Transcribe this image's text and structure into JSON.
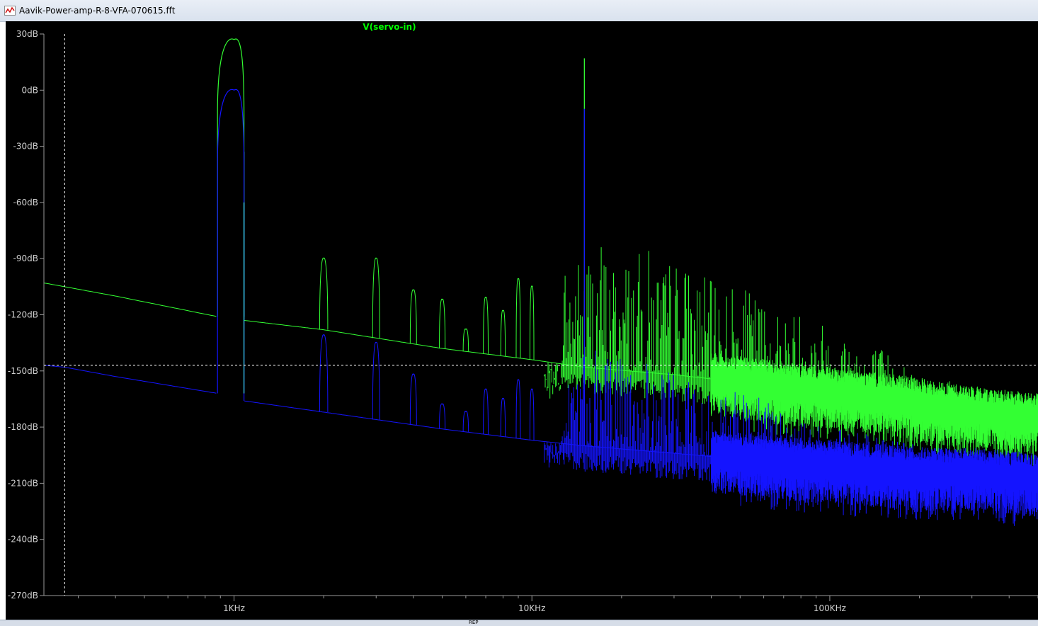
{
  "window": {
    "title": "Aavik-Power-amp-R-8-VFA-070615.fft"
  },
  "status_bar": {
    "fragment": "REP"
  },
  "chart_data": {
    "type": "line",
    "title": "V(servo-in)",
    "xlabel": "",
    "ylabel": "",
    "x_scale": "log",
    "xlim_hz": [
      230,
      500000
    ],
    "ylim_db": [
      -270,
      30
    ],
    "x_ticks": [
      {
        "value": 1000,
        "label": "1KHz"
      },
      {
        "value": 10000,
        "label": "10KHz"
      },
      {
        "value": 100000,
        "label": "100KHz"
      }
    ],
    "y_ticks": [
      {
        "value": 30,
        "label": "30dB"
      },
      {
        "value": 0,
        "label": "0dB"
      },
      {
        "value": -30,
        "label": "-30dB"
      },
      {
        "value": -60,
        "label": "-60dB"
      },
      {
        "value": -90,
        "label": "-90dB"
      },
      {
        "value": -120,
        "label": "-120dB"
      },
      {
        "value": -150,
        "label": "-150dB"
      },
      {
        "value": -180,
        "label": "-180dB"
      },
      {
        "value": -210,
        "label": "-210dB"
      },
      {
        "value": -240,
        "label": "-240dB"
      },
      {
        "value": -270,
        "label": "-270dB"
      }
    ],
    "cursor": {
      "x_hz": 270,
      "y_db": -147
    },
    "colors": {
      "background": "#000000",
      "axis": "#9a9a9a",
      "label": "#cfcfcf",
      "title": "#00ff00",
      "green": "#33ff33",
      "blue": "#1414ff",
      "cyan": "#40e0ff",
      "cursor": "#ffffff"
    },
    "series": [
      {
        "color": "green",
        "baseline": [
          [
            230,
            -103
          ],
          [
            270,
            -105
          ],
          [
            400,
            -110
          ],
          [
            880,
            -121
          ],
          [
            1080,
            -123
          ],
          [
            2000,
            -128
          ],
          [
            5000,
            -138
          ],
          [
            10000,
            -144
          ],
          [
            15000,
            -148
          ],
          [
            30000,
            -152
          ],
          [
            50000,
            -156
          ],
          [
            80000,
            -160
          ],
          [
            100000,
            -162
          ],
          [
            150000,
            -165
          ],
          [
            200000,
            -168
          ],
          [
            300000,
            -172
          ],
          [
            500000,
            -176
          ]
        ],
        "fundamental": {
          "hz": 1000,
          "peak_db": 27,
          "edges_db": -121,
          "width_hz": [
            880,
            1080
          ]
        },
        "harmonics_db": [
          [
            2000,
            -90
          ],
          [
            3000,
            -90
          ],
          [
            4000,
            -107
          ],
          [
            5000,
            -112
          ],
          [
            6000,
            -128
          ],
          [
            7000,
            -111
          ],
          [
            8000,
            -118
          ],
          [
            9000,
            -101
          ],
          [
            10000,
            -105
          ]
        ],
        "spur": {
          "hz": 15000,
          "peak_db": 17
        },
        "spikes_upper_db": [
          [
            12500,
            -94
          ],
          [
            13000,
            -85
          ],
          [
            14000,
            -88
          ],
          [
            16000,
            -77
          ],
          [
            17000,
            -76
          ],
          [
            18500,
            -90
          ],
          [
            20000,
            -82
          ],
          [
            22000,
            -88
          ],
          [
            25000,
            -83
          ],
          [
            28000,
            -92
          ],
          [
            30000,
            -86
          ],
          [
            33000,
            -91
          ],
          [
            36000,
            -95
          ],
          [
            40000,
            -102
          ],
          [
            45000,
            -98
          ],
          [
            50000,
            -108
          ],
          [
            55000,
            -105
          ],
          [
            60000,
            -110
          ],
          [
            70000,
            -117
          ],
          [
            80000,
            -115
          ],
          [
            90000,
            -120
          ],
          [
            100000,
            -123
          ],
          [
            120000,
            -128
          ],
          [
            150000,
            -137
          ],
          [
            180000,
            -145
          ],
          [
            200000,
            -150
          ],
          [
            260000,
            -156
          ],
          [
            300000,
            -160
          ],
          [
            400000,
            -164
          ],
          [
            500000,
            -165
          ]
        ]
      },
      {
        "color": "blue",
        "baseline": [
          [
            230,
            -147
          ],
          [
            270,
            -148
          ],
          [
            400,
            -153
          ],
          [
            880,
            -162
          ],
          [
            1080,
            -166
          ],
          [
            2000,
            -172
          ],
          [
            5000,
            -181
          ],
          [
            10000,
            -187
          ],
          [
            15000,
            -190
          ],
          [
            30000,
            -194
          ],
          [
            50000,
            -197
          ],
          [
            80000,
            -200
          ],
          [
            100000,
            -201
          ],
          [
            150000,
            -203
          ],
          [
            200000,
            -205
          ],
          [
            300000,
            -205
          ],
          [
            500000,
            -208
          ]
        ],
        "fundamental": {
          "hz": 1000,
          "peak_db": 0,
          "edges_db": -162,
          "width_hz": [
            880,
            1080
          ]
        },
        "harmonics_db": [
          [
            2000,
            -131
          ],
          [
            3000,
            -135
          ],
          [
            4000,
            -152
          ],
          [
            5000,
            -168
          ],
          [
            6000,
            -172
          ],
          [
            7000,
            -160
          ],
          [
            8000,
            -165
          ],
          [
            9000,
            -155
          ],
          [
            10000,
            -160
          ]
        ],
        "spur": {
          "hz": 15000,
          "peak_db": -10
        },
        "spikes_upper_db": [
          [
            12500,
            -150
          ],
          [
            13000,
            -145
          ],
          [
            14000,
            -140
          ],
          [
            16000,
            -130
          ],
          [
            17000,
            -135
          ],
          [
            18500,
            -145
          ],
          [
            20000,
            -140
          ],
          [
            22000,
            -148
          ],
          [
            25000,
            -145
          ],
          [
            28000,
            -150
          ],
          [
            30000,
            -148
          ],
          [
            33000,
            -152
          ],
          [
            36000,
            -155
          ],
          [
            40000,
            -158
          ],
          [
            50000,
            -160
          ],
          [
            60000,
            -165
          ],
          [
            70000,
            -170
          ],
          [
            80000,
            -175
          ],
          [
            100000,
            -180
          ],
          [
            150000,
            -185
          ],
          [
            200000,
            -190
          ],
          [
            300000,
            -193
          ],
          [
            500000,
            -195
          ]
        ]
      }
    ]
  }
}
